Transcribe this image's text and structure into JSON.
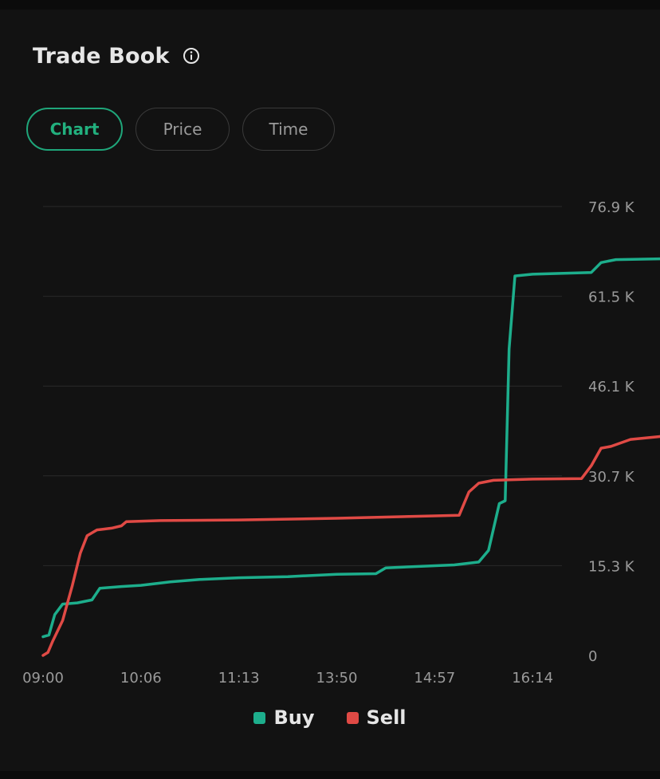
{
  "header": {
    "title": "Trade Book"
  },
  "tabs": [
    {
      "label": "Chart",
      "active": true
    },
    {
      "label": "Price",
      "active": false
    },
    {
      "label": "Time",
      "active": false
    }
  ],
  "colors": {
    "buy": "#1dae8c",
    "sell": "#e04a45",
    "accent": "#1fa67a",
    "grid": "#2a2a2a",
    "tick": "#9a9a9a"
  },
  "chart_data": {
    "type": "line",
    "title": "",
    "xlabel": "",
    "ylabel": "",
    "x_ticks": [
      "09:00",
      "10:06",
      "11:13",
      "13:50",
      "14:57",
      "16:14"
    ],
    "y_ticks": [
      "0",
      "15.3 K",
      "30.7 K",
      "46.1 K",
      "61.5 K",
      "76.9 K"
    ],
    "ylim": [
      0,
      76.9
    ],
    "y_unit": "K",
    "y_axis_position": "right",
    "grid": true,
    "legend": "bottom-center",
    "series": [
      {
        "name": "Buy",
        "color": "#1dae8c",
        "points": [
          [
            0,
            3.2
          ],
          [
            0.06,
            3.5
          ],
          [
            0.12,
            7.0
          ],
          [
            0.2,
            8.8
          ],
          [
            0.35,
            9.0
          ],
          [
            0.5,
            9.5
          ],
          [
            0.58,
            11.5
          ],
          [
            0.8,
            11.8
          ],
          [
            1.0,
            12.0
          ],
          [
            1.3,
            12.6
          ],
          [
            1.6,
            13.0
          ],
          [
            2.0,
            13.3
          ],
          [
            2.5,
            13.5
          ],
          [
            3.0,
            13.9
          ],
          [
            3.4,
            14.0
          ],
          [
            3.5,
            15.0
          ],
          [
            4.2,
            15.5
          ],
          [
            4.45,
            16.0
          ],
          [
            4.55,
            18.0
          ],
          [
            4.66,
            26.0
          ],
          [
            4.72,
            26.5
          ],
          [
            4.76,
            52.5
          ],
          [
            4.82,
            65.0
          ],
          [
            5.0,
            65.3
          ],
          [
            5.6,
            65.6
          ],
          [
            5.7,
            67.3
          ],
          [
            5.85,
            67.8
          ],
          [
            6.5,
            68.0
          ],
          [
            7.0,
            68.3
          ],
          [
            7.2,
            68.7
          ],
          [
            7.3,
            69.0
          ]
        ]
      },
      {
        "name": "Sell",
        "color": "#e04a45",
        "points": [
          [
            0,
            0
          ],
          [
            0.05,
            0.5
          ],
          [
            0.1,
            2.5
          ],
          [
            0.2,
            6.0
          ],
          [
            0.3,
            12.0
          ],
          [
            0.38,
            17.5
          ],
          [
            0.45,
            20.5
          ],
          [
            0.55,
            21.5
          ],
          [
            0.7,
            21.8
          ],
          [
            0.8,
            22.2
          ],
          [
            0.85,
            22.9
          ],
          [
            1.2,
            23.1
          ],
          [
            2.0,
            23.2
          ],
          [
            3.0,
            23.5
          ],
          [
            4.0,
            23.9
          ],
          [
            4.25,
            24.0
          ],
          [
            4.35,
            28.0
          ],
          [
            4.45,
            29.5
          ],
          [
            4.6,
            30.0
          ],
          [
            5.0,
            30.2
          ],
          [
            5.5,
            30.3
          ],
          [
            5.6,
            32.5
          ],
          [
            5.7,
            35.5
          ],
          [
            5.8,
            35.8
          ],
          [
            6.0,
            37.0
          ],
          [
            6.3,
            37.5
          ],
          [
            6.45,
            38.5
          ],
          [
            6.55,
            40.0
          ],
          [
            6.8,
            40.6
          ],
          [
            7.3,
            41.0
          ]
        ]
      }
    ]
  }
}
